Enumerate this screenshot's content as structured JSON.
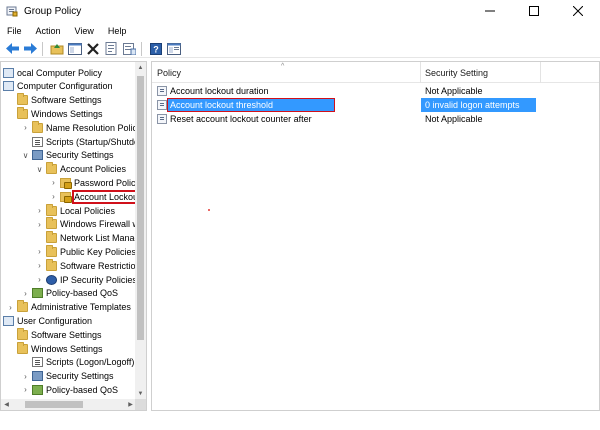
{
  "window": {
    "title": "Group Policy",
    "controls": {
      "minimize": "minimize",
      "maximize": "maximize",
      "close": "close"
    }
  },
  "menu": [
    "File",
    "Action",
    "View",
    "Help"
  ],
  "toolbar": {
    "buttons": [
      "back-icon",
      "forward-icon",
      "up-folder-icon",
      "show-hide-tree-icon",
      "delete-icon",
      "properties-icon",
      "export-list-icon",
      "help-icon",
      "view-icon"
    ]
  },
  "tree": {
    "items": [
      {
        "label": "ocal Computer Policy",
        "icon": "computer-icon",
        "indent": 0,
        "expander": ""
      },
      {
        "label": "Computer Configuration",
        "icon": "computer-icon",
        "indent": 0,
        "expander": ""
      },
      {
        "label": "Software Settings",
        "icon": "folder-icon",
        "indent": 1,
        "expander": ""
      },
      {
        "label": "Windows Settings",
        "icon": "folder-icon",
        "indent": 1,
        "expander": ""
      },
      {
        "label": "Name Resolution Policy",
        "icon": "folder-icon",
        "indent": 2,
        "expander": ">"
      },
      {
        "label": "Scripts (Startup/Shutdow",
        "icon": "script-icon",
        "indent": 2,
        "expander": ""
      },
      {
        "label": "Security Settings",
        "icon": "security-icon",
        "indent": 2,
        "expander": "v"
      },
      {
        "label": "Account Policies",
        "icon": "folder-icon",
        "indent": 3,
        "expander": "v"
      },
      {
        "label": "Password Policy",
        "icon": "lock-folder-icon",
        "indent": 4,
        "expander": ">"
      },
      {
        "label": "Account Lockout",
        "icon": "lock-folder-icon",
        "indent": 4,
        "expander": ">",
        "selected": true
      },
      {
        "label": "Local Policies",
        "icon": "folder-icon",
        "indent": 3,
        "expander": ">"
      },
      {
        "label": "Windows Firewall wit",
        "icon": "folder-icon",
        "indent": 3,
        "expander": ">"
      },
      {
        "label": "Network List Manage",
        "icon": "folder-icon",
        "indent": 3,
        "expander": ""
      },
      {
        "label": "Public Key Policies",
        "icon": "folder-icon",
        "indent": 3,
        "expander": ">"
      },
      {
        "label": "Software Restriction",
        "icon": "folder-icon",
        "indent": 3,
        "expander": ">"
      },
      {
        "label": "IP Security Policies or",
        "icon": "ipsec-icon",
        "indent": 3,
        "expander": ">"
      },
      {
        "label": "Policy-based QoS",
        "icon": "qos-icon",
        "indent": 2,
        "expander": ">"
      },
      {
        "label": "Administrative Templates",
        "icon": "folder-icon",
        "indent": 1,
        "expander": ">"
      },
      {
        "label": "User Configuration",
        "icon": "computer-icon",
        "indent": 0,
        "expander": ""
      },
      {
        "label": "Software Settings",
        "icon": "folder-icon",
        "indent": 1,
        "expander": ""
      },
      {
        "label": "Windows Settings",
        "icon": "folder-icon",
        "indent": 1,
        "expander": ""
      },
      {
        "label": "Scripts (Logon/Logoff)",
        "icon": "script-icon",
        "indent": 2,
        "expander": ""
      },
      {
        "label": "Security Settings",
        "icon": "security-icon",
        "indent": 2,
        "expander": ">"
      },
      {
        "label": "Policy-based QoS",
        "icon": "qos-icon",
        "indent": 2,
        "expander": ">"
      }
    ]
  },
  "list": {
    "columns": [
      "Policy",
      "Security Setting"
    ],
    "rows": [
      {
        "policy": "Account lockout duration",
        "setting": "Not Applicable"
      },
      {
        "policy": "Account lockout threshold",
        "setting": "0 invalid logon attempts",
        "selected": true
      },
      {
        "policy": "Reset account lockout counter after",
        "setting": "Not Applicable"
      }
    ]
  },
  "colors": {
    "selection": "#3399ff",
    "highlight_box": "#d0101a"
  }
}
